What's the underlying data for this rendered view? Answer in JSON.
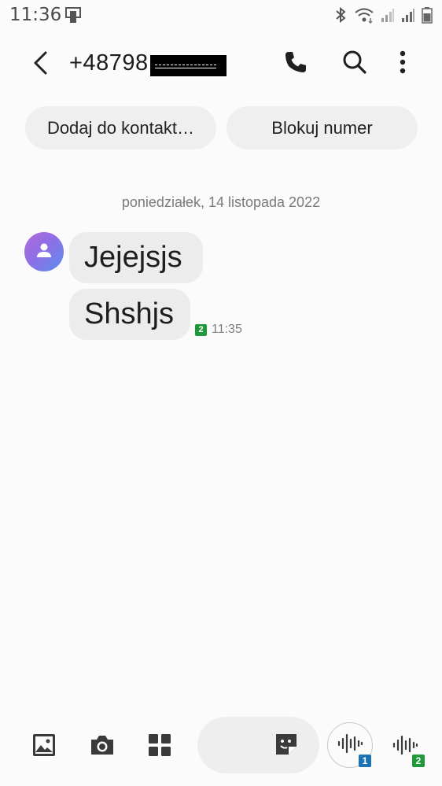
{
  "status_bar": {
    "time": "11:36",
    "icons": [
      "phone-mirror-icon",
      "bluetooth-icon",
      "wifi-icon",
      "signal-1-icon",
      "signal-2-icon",
      "battery-icon"
    ]
  },
  "header": {
    "title": "+48798",
    "back_icon": "back-arrow-icon",
    "call_icon": "phone-icon",
    "search_icon": "search-icon",
    "more_icon": "more-vertical-icon"
  },
  "actions": {
    "add_contact": "Dodaj do kontakt…",
    "block_number": "Blokuj numer"
  },
  "conversation": {
    "date": "poniedziałek, 14 listopada 2022",
    "messages": [
      {
        "text": "Jejejsjs"
      },
      {
        "text": "Shshjs"
      }
    ],
    "last_time": "11:35",
    "sim": "2"
  },
  "bottom_bar": {
    "gallery_icon": "gallery-icon",
    "camera_icon": "camera-icon",
    "apps_icon": "apps-grid-icon",
    "sticker_icon": "sticker-icon",
    "voice_sim1": "1",
    "voice_sim2": "2"
  },
  "colors": {
    "background": "#fbfbfb",
    "bubble": "#ececec",
    "chip": "#efefef",
    "sim1": "#1b73b4",
    "sim2": "#1e9a3a"
  }
}
